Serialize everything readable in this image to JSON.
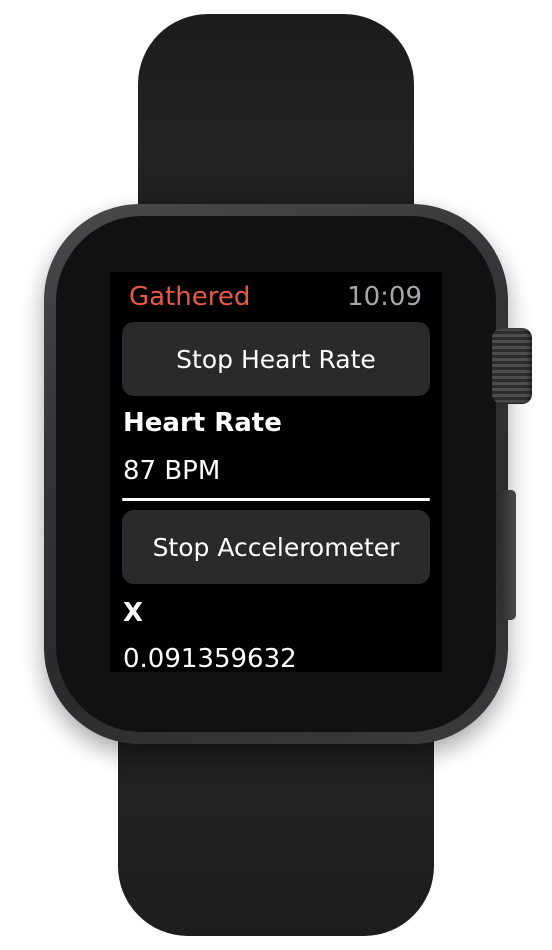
{
  "status_bar": {
    "app_title": "Gathered",
    "time": "10:09"
  },
  "heart_rate": {
    "button_label": "Stop Heart Rate",
    "label": "Heart Rate",
    "value": "87 BPM"
  },
  "accelerometer": {
    "button_label": "Stop Accelerometer",
    "x_label": "X",
    "x_value": "0.091359632"
  },
  "colors": {
    "accent": "#e5584a",
    "button_bg": "#2a2a2c",
    "clock": "#a7a7ab"
  }
}
